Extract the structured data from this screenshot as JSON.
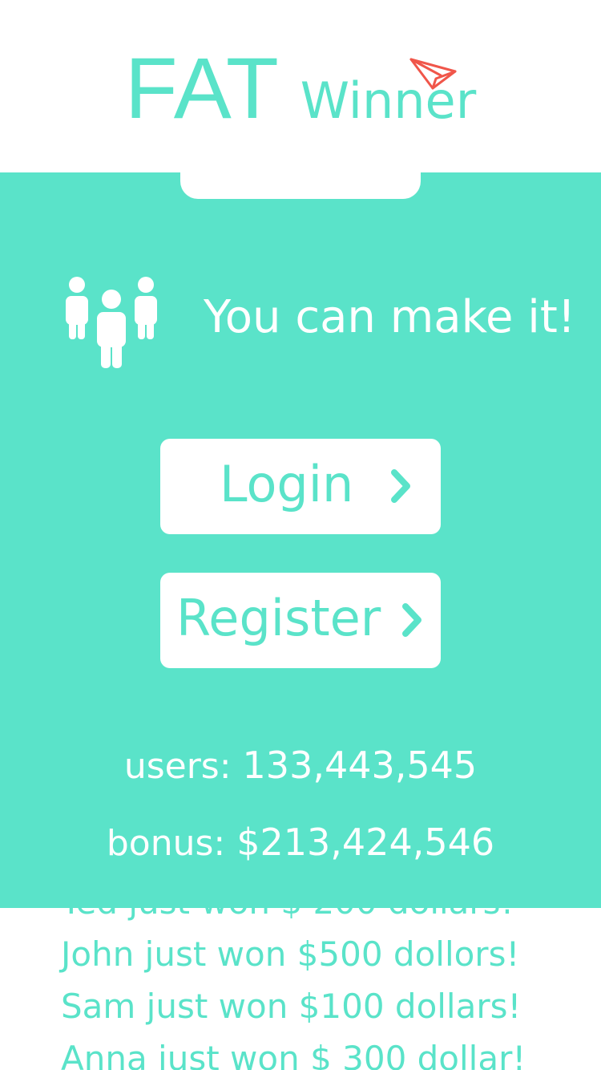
{
  "header": {
    "logo_main": "FAT",
    "logo_sub": "Winner",
    "logo_icon": "paper-plane-icon"
  },
  "colors": {
    "accent": "#5ae3c9",
    "plane": "#f0564a",
    "background": "#ffffff"
  },
  "panel": {
    "icon": "users-group-icon",
    "motto": "You can make it!",
    "login_label": "Login",
    "register_label": "Register",
    "chevron_icon": "chevron-right-icon",
    "users_label": "users: ",
    "users_value": "133,443,545",
    "bonus_label": "bonus: ",
    "bonus_value": "$213,424,546"
  },
  "ticker": {
    "items": [
      "Ted just won $ 200 dollars!",
      "John just won $500 dollors!",
      "Sam just won $100 dollars!",
      "Anna just won $ 300 dollar!"
    ]
  }
}
